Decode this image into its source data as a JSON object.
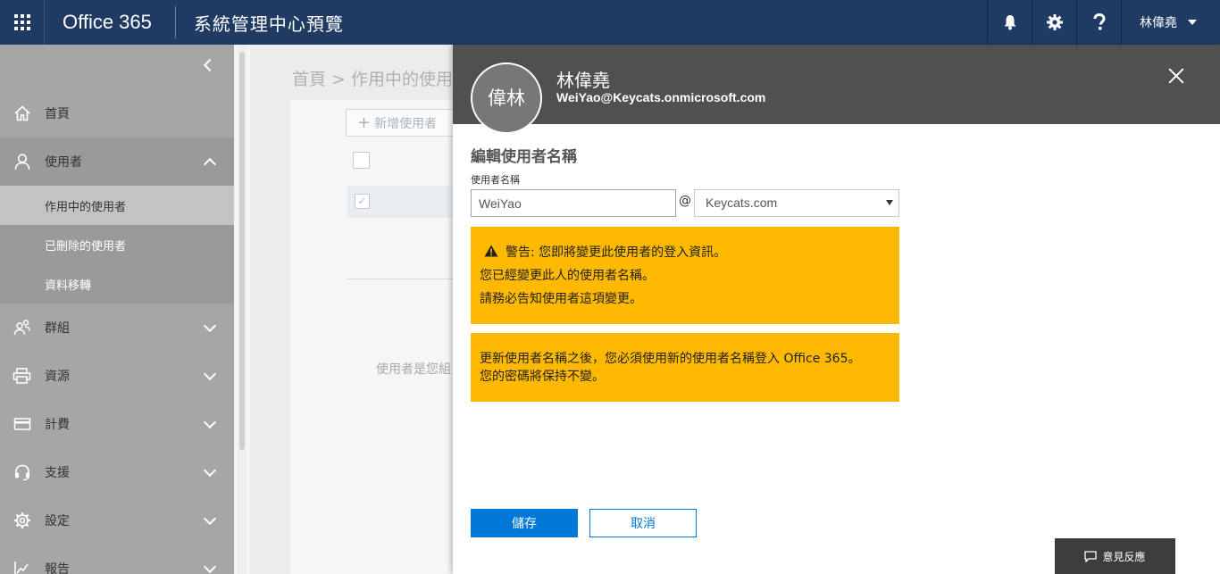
{
  "topbar": {
    "brand": "Office 365",
    "app_title": "系統管理中心預覽",
    "user_name": "林偉堯"
  },
  "sidebar": {
    "items": [
      {
        "label": "首頁",
        "icon": "home-icon"
      },
      {
        "label": "使用者",
        "icon": "user-icon",
        "expanded": true,
        "children": [
          {
            "label": "作用中的使用者",
            "selected": true
          },
          {
            "label": "已刪除的使用者"
          },
          {
            "label": "資料移轉"
          }
        ]
      },
      {
        "label": "群組",
        "icon": "group-icon"
      },
      {
        "label": "資源",
        "icon": "printer-icon"
      },
      {
        "label": "計費",
        "icon": "card-icon"
      },
      {
        "label": "支援",
        "icon": "headset-icon"
      },
      {
        "label": "設定",
        "icon": "gear-icon"
      },
      {
        "label": "報告",
        "icon": "chart-icon"
      }
    ]
  },
  "background": {
    "breadcrumb": "首頁 > 作用中的使用",
    "add_user": "新增使用者",
    "hint": "使用者是您組"
  },
  "panel": {
    "avatar_initials": "偉林",
    "name": "林偉堯",
    "email": "WeiYao@Keycats.onmicrosoft.com",
    "section_title": "編輯使用者名稱",
    "field_label": "使用者名稱",
    "username_value": "WeiYao",
    "at": "@",
    "domain_value": "Keycats.com",
    "warning1": {
      "line1": "警告: 您即將變更此使用者的登入資訊。",
      "line2": "您已經變更此人的使用者名稱。",
      "line3": "請務必告知使用者這項變更。"
    },
    "warning2": {
      "line1": "更新使用者名稱之後，您必須使用新的使用者名稱登入 Office 365。",
      "line2": "您的密碼將保持不變。"
    },
    "save_label": "儲存",
    "cancel_label": "取消",
    "feedback_label": "意見反應"
  },
  "colors": {
    "topbar": "#1f3b64",
    "primary": "#0078d7",
    "warning": "#ffb900",
    "panel_header": "#505050"
  }
}
